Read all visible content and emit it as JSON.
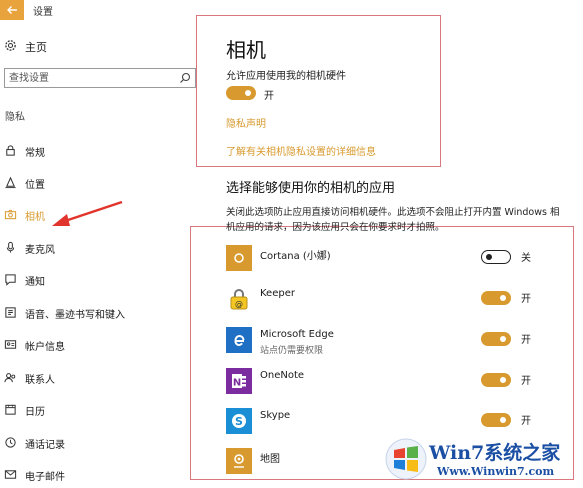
{
  "window": {
    "title": "设置"
  },
  "sidebar": {
    "home_label": "主页",
    "search_placeholder": "查找设置",
    "section_label": "隐私",
    "items": [
      {
        "label": "常规",
        "icon": "lock-icon"
      },
      {
        "label": "位置",
        "icon": "location-icon"
      },
      {
        "label": "相机",
        "icon": "camera-icon",
        "active": true
      },
      {
        "label": "麦克风",
        "icon": "microphone-icon"
      },
      {
        "label": "通知",
        "icon": "notification-icon"
      },
      {
        "label": "语音、墨迹书写和键入",
        "icon": "speech-icon"
      },
      {
        "label": "帐户信息",
        "icon": "account-icon"
      },
      {
        "label": "联系人",
        "icon": "contacts-icon"
      },
      {
        "label": "日历",
        "icon": "calendar-icon"
      },
      {
        "label": "通话记录",
        "icon": "call-history-icon"
      },
      {
        "label": "电子邮件",
        "icon": "email-icon"
      }
    ]
  },
  "main": {
    "title": "相机",
    "allow_label": "允许应用使用我的相机硬件",
    "allow_toggle": {
      "on": true,
      "state_label": "开"
    },
    "privacy_link": "隐私声明",
    "details_link": "了解有关相机隐私设置的详细信息",
    "apps_heading": "选择能够使用你的相机的应用",
    "apps_desc": "关闭此选项防止应用直接访问相机硬件。此选项不会阻止打开内置 Windows 相机应用的请求，因为该应用只会在你要求时才拍照。",
    "apps": [
      {
        "name": "Cortana (小娜)",
        "subtitle": "",
        "icon": "cortana-icon",
        "on": false,
        "state_label": "关"
      },
      {
        "name": "Keeper",
        "subtitle": "",
        "icon": "keeper-icon",
        "on": true,
        "state_label": "开"
      },
      {
        "name": "Microsoft Edge",
        "subtitle": "站点仍需要权限",
        "icon": "edge-icon",
        "on": true,
        "state_label": "开"
      },
      {
        "name": "OneNote",
        "subtitle": "",
        "icon": "onenote-icon",
        "on": true,
        "state_label": "开"
      },
      {
        "name": "Skype",
        "subtitle": "",
        "icon": "skype-icon",
        "on": true,
        "state_label": "开"
      },
      {
        "name": "地图",
        "subtitle": "",
        "icon": "maps-icon",
        "on": null,
        "state_label": ""
      }
    ]
  },
  "watermark": {
    "title": "Win7系统之家",
    "url": "Www.Winwin7.com"
  },
  "colors": {
    "accent": "#d89a2e",
    "highlight": "#d9777e",
    "watermark": "#1b4fa3"
  }
}
